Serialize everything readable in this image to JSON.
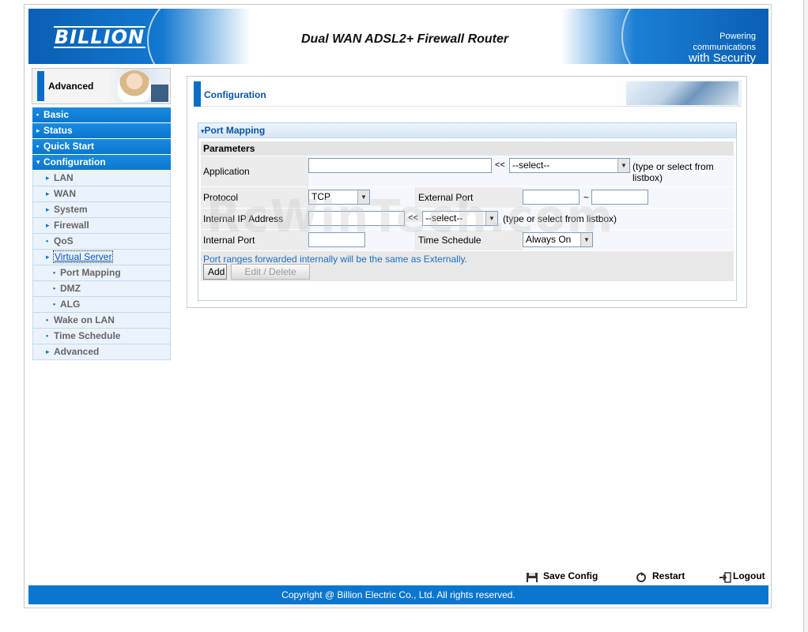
{
  "header": {
    "logo": "BILLION",
    "title": "Dual WAN ADSL2+ Firewall Router",
    "tagline_line1": "Powering communications",
    "tagline_line2": "with Security"
  },
  "sidebar": {
    "banner_label": "Advanced",
    "items": [
      {
        "label": "Basic",
        "level": "top",
        "marker": "•"
      },
      {
        "label": "Status",
        "level": "top",
        "marker": "▸"
      },
      {
        "label": "Quick Start",
        "level": "top",
        "marker": "•"
      },
      {
        "label": "Configuration",
        "level": "top",
        "marker": "▾"
      },
      {
        "label": "LAN",
        "level": "sub",
        "marker": "▸"
      },
      {
        "label": "WAN",
        "level": "sub",
        "marker": "▸"
      },
      {
        "label": "System",
        "level": "sub",
        "marker": "▸"
      },
      {
        "label": "Firewall",
        "level": "sub",
        "marker": "▸"
      },
      {
        "label": "QoS",
        "level": "sub",
        "marker": "•"
      },
      {
        "label": "Virtual Server",
        "level": "sub",
        "marker": "▸"
      },
      {
        "label": "Port Mapping",
        "level": "subsub",
        "marker": "•"
      },
      {
        "label": "DMZ",
        "level": "subsub",
        "marker": "•"
      },
      {
        "label": "ALG",
        "level": "subsub",
        "marker": "•"
      },
      {
        "label": "Wake on LAN",
        "level": "sub",
        "marker": "•"
      },
      {
        "label": "Time Schedule",
        "level": "sub",
        "marker": "•"
      },
      {
        "label": "Advanced",
        "level": "sub",
        "marker": "▸"
      }
    ]
  },
  "main": {
    "section_title": "Configuration",
    "box_title": "Port Mapping",
    "params_header": "Parameters",
    "application_label": "Application",
    "application_value": "",
    "chevron": "<<",
    "app_select_value": "--select--",
    "app_hint": "(type or select from listbox)",
    "protocol_label": "Protocol",
    "protocol_value": "TCP",
    "external_port_label": "External Port",
    "external_port_from": "",
    "tilde": "~",
    "external_port_to": "",
    "internal_ip_label": "Internal IP Address",
    "internal_ip_value": "",
    "ip_select_value": "--select--",
    "ip_hint": "(type or select from listbox)",
    "internal_port_label": "Internal Port",
    "internal_port_value": "",
    "time_schedule_label": "Time Schedule",
    "time_schedule_value": "Always On",
    "note": "Port ranges forwarded internally will be the same as Externally.",
    "add_label": "Add",
    "edit_label": "Edit / Delete"
  },
  "footer": {
    "save_label": "Save Config",
    "restart_label": "Restart",
    "logout_label": "Logout",
    "copyright": "Copyright @ Billion Electric Co., Ltd. All rights reserved."
  },
  "watermark": "RcWinTech.com"
}
